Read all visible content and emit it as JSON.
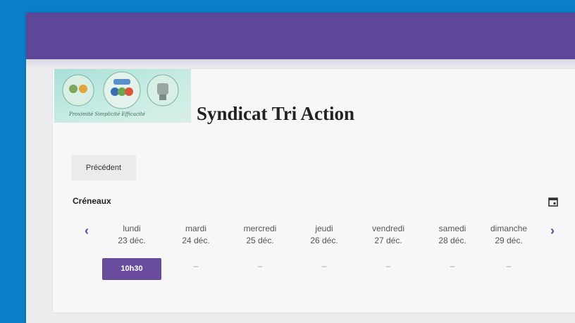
{
  "header": {
    "org_name": "Syndicat Tri Action",
    "logo_caption": "Proximité  Simplicité  Efficacité"
  },
  "nav": {
    "previous_label": "Précédent"
  },
  "section": {
    "title": "Créneaux"
  },
  "week": {
    "days": [
      {
        "name": "lundi",
        "date": "23 déc."
      },
      {
        "name": "mardi",
        "date": "24 déc."
      },
      {
        "name": "mercredi",
        "date": "25 déc."
      },
      {
        "name": "jeudi",
        "date": "26 déc."
      },
      {
        "name": "vendredi",
        "date": "27 déc."
      },
      {
        "name": "samedi",
        "date": "28 déc."
      },
      {
        "name": "dimanche",
        "date": "29 déc."
      }
    ],
    "slots": [
      "10h30",
      "–",
      "–",
      "–",
      "–",
      "–",
      "–"
    ],
    "prev_arrow": "‹",
    "next_arrow": "›"
  },
  "colors": {
    "brand_purple": "#5e4699",
    "slot_purple": "#6a4c9c",
    "background_blue": "#0a7ec6"
  },
  "icons": {
    "calendar": "calendar-icon",
    "prev": "chevron-left-icon",
    "next": "chevron-right-icon"
  }
}
